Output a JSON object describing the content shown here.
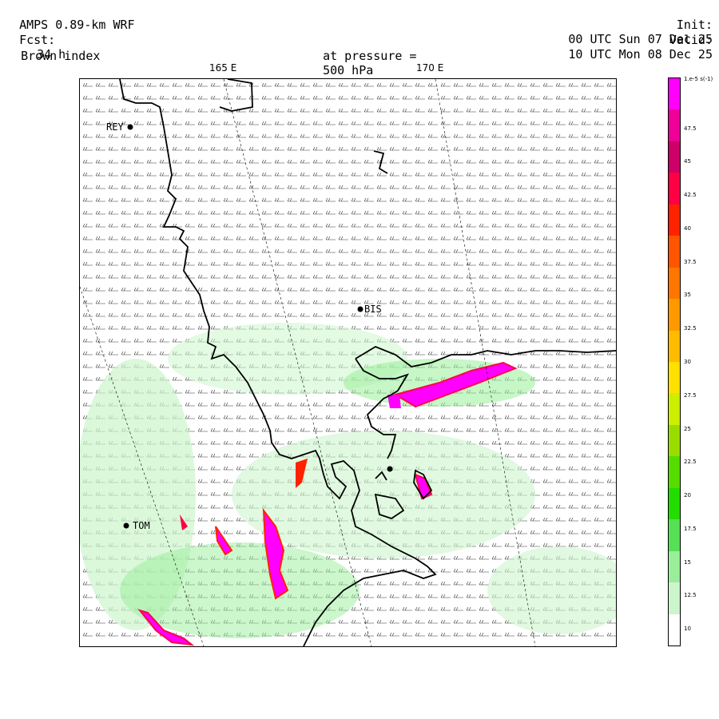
{
  "header": {
    "model": "AMPS 0.89-km WRF",
    "forecast_label": "Fcst:",
    "forecast_value": "34 h",
    "field": "Brown index",
    "init_label": "Init:",
    "init_value": "00 UTC Sun 07 Dec 25",
    "valid_label": "Valid:",
    "valid_value": "10 UTC Mon 08 Dec 25",
    "level_label": "at pressure =",
    "level_value": "500 hPa"
  },
  "map": {
    "longitude_labels": [
      "165 E",
      "170 E"
    ],
    "stations": [
      {
        "name": "REY"
      },
      {
        "name": "BIS"
      },
      {
        "name": "TOM"
      },
      {
        "name": ""
      }
    ]
  },
  "colorbar": {
    "units_label": "1.e-5 s(-1)",
    "tick_labels": [
      "47.5",
      "45",
      "42.5",
      "40",
      "37.5",
      "35",
      "32.5",
      "30",
      "27.5",
      "25",
      "22.5",
      "20",
      "17.5",
      "15",
      "12.5",
      "10"
    ],
    "colors": [
      "#ff00ff",
      "#ee0099",
      "#cc0066",
      "#ff0044",
      "#ff2200",
      "#ff5500",
      "#ff7700",
      "#ff9900",
      "#ffbb00",
      "#ffe000",
      "#ccee00",
      "#99dd00",
      "#55dd00",
      "#22dd00",
      "#55e055",
      "#99ee99",
      "#ccf5cc",
      "#ffffff"
    ]
  }
}
